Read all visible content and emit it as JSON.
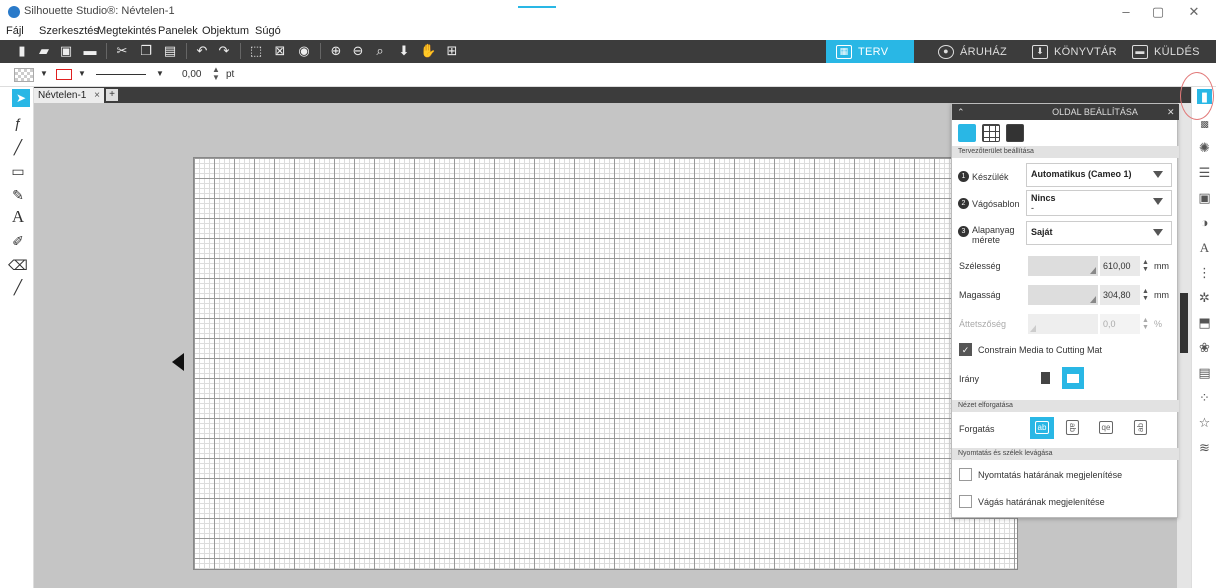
{
  "window": {
    "title": "Silhouette Studio®: Névtelen-1",
    "minimize": "–",
    "restore": "▢",
    "close": "✕"
  },
  "menu": [
    "Fájl",
    "Szerkesztés",
    "Megtekintés",
    "Panelek",
    "Objektum",
    "Súgó"
  ],
  "nav_tabs": {
    "design": "TERV",
    "store": "ÁRUHÁZ",
    "library": "KÖNYVTÁR",
    "send": "KÜLDÉS"
  },
  "options_bar": {
    "line_width": "0,00",
    "unit": "pt"
  },
  "document": {
    "tab": "Névtelen-1",
    "close": "×",
    "add": "+"
  },
  "panel": {
    "title": "OLDAL BEÁLLÍTÁSA",
    "section_workspace": "Tervezőterület beállítása",
    "device": {
      "num": "1",
      "label": "Készülék",
      "value": "Automatikus (Cameo 1)"
    },
    "cutting_mat": {
      "num": "2",
      "label": "Vágósablon",
      "value": "Nincs",
      "sub": "-"
    },
    "media_size": {
      "num": "3",
      "label1": "Alapanyag",
      "label2": "mérete",
      "value": "Saját"
    },
    "width": {
      "label": "Szélesség",
      "value": "610,00",
      "unit": "mm"
    },
    "height": {
      "label": "Magasság",
      "value": "304,80",
      "unit": "mm"
    },
    "transparency": {
      "label": "Áttetszőség",
      "value": "0,0",
      "unit": "%"
    },
    "constrain": "Constrain Media to Cutting Mat",
    "orientation": "Irány",
    "section_view": "Nézet elforgatása",
    "rotation": {
      "label": "Forgatás",
      "opts": [
        "ab",
        "ab",
        "qe",
        "ab"
      ]
    },
    "section_print": "Nyomtatás és szélek levágása",
    "show_print_border": "Nyomtatás határának megjelenítése",
    "show_cut_border": "Vágás határának megjelenítése"
  },
  "colors": {
    "accent": "#29b7e5",
    "toolbar": "#3c3c3c",
    "canvas": "#c5c5c5"
  }
}
